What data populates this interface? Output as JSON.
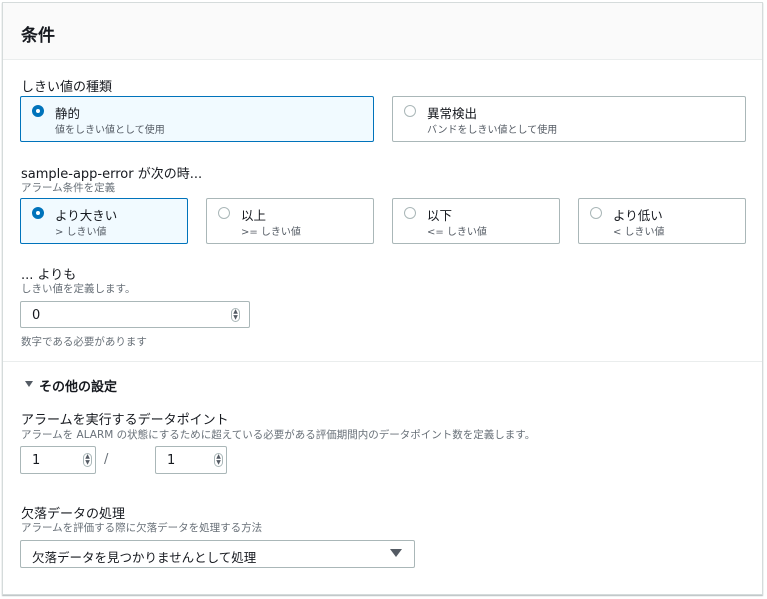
{
  "panel": {
    "title": "条件"
  },
  "threshold_type": {
    "label": "しきい値の種類",
    "options": [
      {
        "title": "静的",
        "desc": "値をしきい値として使用"
      },
      {
        "title": "異常検出",
        "desc": "バンドをしきい値として使用"
      }
    ]
  },
  "condition": {
    "label": "sample-app-error が次の時...",
    "desc": "アラーム条件を定義",
    "options": [
      {
        "title": "より大きい",
        "desc": "> しきい値"
      },
      {
        "title": "以上",
        "desc": ">= しきい値"
      },
      {
        "title": "以下",
        "desc": "<= しきい値"
      },
      {
        "title": "より低い",
        "desc": "< しきい値"
      }
    ]
  },
  "threshold": {
    "label": "... よりも",
    "desc": "しきい値を定義します。",
    "value": "0",
    "hint": "数字である必要があります"
  },
  "additional": {
    "toggle_label": "その他の設定",
    "datapoints": {
      "label": "アラームを実行するデータポイント",
      "desc": "アラームを ALARM の状態にするために超えている必要がある評価期間内のデータポイント数を定義します。",
      "value1": "1",
      "separator": "/",
      "value2": "1"
    },
    "missing_data": {
      "label": "欠落データの処理",
      "desc": "アラームを評価する際に欠落データを処理する方法",
      "selected": "欠落データを見つかりませんとして処理"
    }
  },
  "colors": {
    "accent": "#0073bb",
    "selected_bg": "#f1faff",
    "border": "#aab7b8"
  }
}
